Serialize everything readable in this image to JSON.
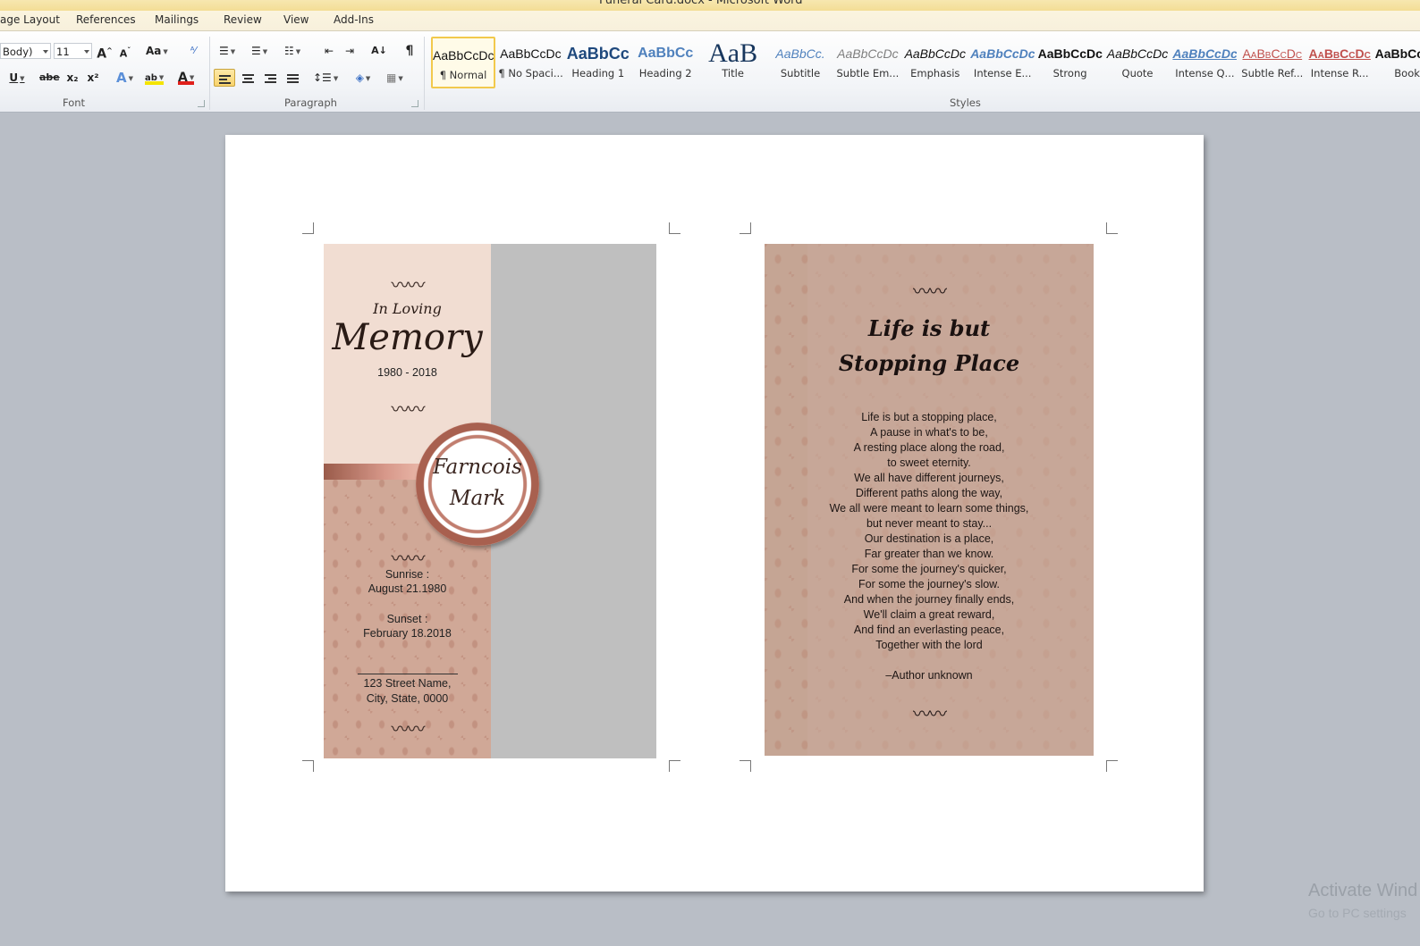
{
  "window": {
    "title": "Funeral Card.docx - Microsoft Word"
  },
  "tabs": [
    "age Layout",
    "References",
    "Mailings",
    "Review",
    "View",
    "Add-Ins"
  ],
  "ribbon": {
    "font": {
      "name_value": "Body)",
      "size_value": "11",
      "grow": "A",
      "shrink": "A",
      "change_case": "Aa",
      "underline": "U",
      "strikethrough": "abe",
      "subscript": "x₂",
      "superscript": "x²",
      "text_effects": "A",
      "highlight": "ab",
      "font_color": "A",
      "group_label": "Font"
    },
    "paragraph": {
      "pilcrow": "¶",
      "group_label": "Paragraph"
    },
    "styles": {
      "group_label": "Styles",
      "items": [
        {
          "sample": "AaBbCcDc",
          "name": "¶ Normal"
        },
        {
          "sample": "AaBbCcDc",
          "name": "¶ No Spaci..."
        },
        {
          "sample": "AaBbCc",
          "name": "Heading 1"
        },
        {
          "sample": "AaBbCc",
          "name": "Heading 2"
        },
        {
          "sample": "AaB",
          "name": "Title"
        },
        {
          "sample": "AaBbCc.",
          "name": "Subtitle"
        },
        {
          "sample": "AaBbCcDc",
          "name": "Subtle Em..."
        },
        {
          "sample": "AaBbCcDc",
          "name": "Emphasis"
        },
        {
          "sample": "AaBbCcDc",
          "name": "Intense E..."
        },
        {
          "sample": "AaBbCcDc",
          "name": "Strong"
        },
        {
          "sample": "AaBbCcDc",
          "name": "Quote"
        },
        {
          "sample": "AaBbCcDc",
          "name": "Intense Q..."
        },
        {
          "sample": "AaBbCcDc",
          "name": "Subtle Ref..."
        },
        {
          "sample": "AaBbCcDc",
          "name": "Intense R..."
        },
        {
          "sample": "AaBbCcDc",
          "name": "Book"
        }
      ]
    }
  },
  "card_left": {
    "ornament": "〰〰",
    "in_loving": "In Loving",
    "memory": "Memory",
    "years": "1980 - 2018",
    "name_first": "Farncois",
    "name_last": "Mark",
    "sunrise_label": "Sunrise :",
    "sunrise_date": "August 21.1980",
    "sunset_label": "Sunset :",
    "sunset_date": "February 18.2018",
    "address_line1": "123 Street Name,",
    "address_line2": "City, State, 0000"
  },
  "card_right": {
    "ornament": "〰〰",
    "title_line1": "Life is but",
    "title_line2": "Stopping Place",
    "poem": [
      "Life is but a stopping place,",
      "A pause in what's to be,",
      "A resting place along the road,",
      "to sweet eternity.",
      "We all have different journeys,",
      "Different paths along the way,",
      "We all were meant to learn some things,",
      "but never meant to stay...",
      "Our destination is a place,",
      "Far greater than we know.",
      "For some the journey's quicker,",
      "For some the journey's slow.",
      "And when the journey finally ends,",
      "We'll claim a great reward,",
      "And find an everlasting peace,",
      "Together with the lord"
    ],
    "author": "–Author unknown"
  },
  "watermark": {
    "line1": "Activate Wind",
    "line2": "Go to PC settings"
  },
  "colors": {
    "accent": "#f2c94c",
    "card_light": "#f1ddd2",
    "card_pattern": "#d3aa98",
    "photo_placeholder": "#bfbfbf"
  }
}
